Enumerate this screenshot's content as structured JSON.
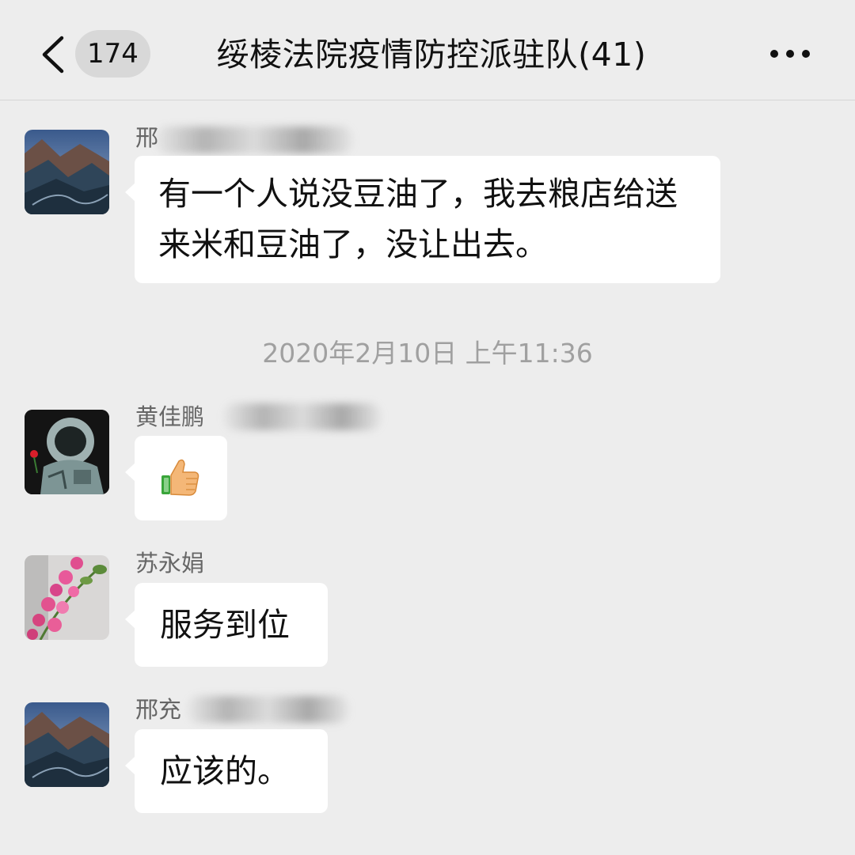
{
  "header": {
    "back_icon": "chevron-left-icon",
    "unread_count": "174",
    "title": "绥棱法院疫情防控派驻队(41)",
    "more_icon": "ellipsis-icon"
  },
  "messages": [
    {
      "sender": "邢",
      "text": "有一个人说没豆油了，我去粮店给送来米和豆油了，没让出去。",
      "avatar": "mountain-landscape"
    },
    {
      "sender": "黄佳鹏",
      "text": "",
      "emoji": "thumbs-up-emoji",
      "avatar": "astronaut-with-rose"
    },
    {
      "sender": "苏永娟",
      "text": "服务到位",
      "avatar": "pink-flowers"
    },
    {
      "sender": "邢充",
      "text": "应该的。",
      "avatar": "mountain-landscape"
    }
  ],
  "timestamp": "2020年2月10日 上午11:36",
  "colors": {
    "background": "#ededed",
    "bubble": "#ffffff",
    "name_text": "#666666",
    "time_text": "#a0a0a0"
  }
}
